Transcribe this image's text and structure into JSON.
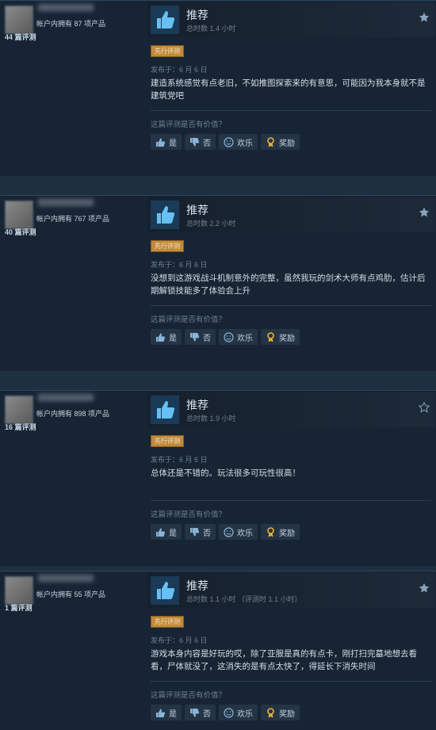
{
  "reviews": [
    {
      "products": "帐户内拥有 87 项产品",
      "review_count": "44 篇评测",
      "recommend": "推荐",
      "hours": "总时数 1.4 小时",
      "early_access": "先行评测",
      "posted": "发布于：6 月 6 日",
      "text": "建造系统感觉有点老旧，不如推图探索来的有意思，可能因为我本身就不是建筑党吧",
      "helpful_q": "这篇评测是否有价值？",
      "btn_yes": "是",
      "btn_no": "否",
      "btn_funny": "欢乐",
      "btn_award": "奖励",
      "star_filled": true
    },
    {
      "products": "帐户内拥有 767 项产品",
      "review_count": "40 篇评测",
      "recommend": "推荐",
      "hours": "总时数 2.2 小时",
      "early_access": "先行评测",
      "posted": "发布于：6 月 6 日",
      "text": "没想到这游戏战斗机制意外的完整，虽然我玩的剑术大师有点鸡肋，估计后期解锁技能多了体验会上升",
      "helpful_q": "这篇评测是否有价值？",
      "btn_yes": "是",
      "btn_no": "否",
      "btn_funny": "欢乐",
      "btn_award": "奖励",
      "star_filled": true
    },
    {
      "products": "帐户内拥有 898 项产品",
      "review_count": "16 篇评测",
      "recommend": "推荐",
      "hours": "总时数 1.9 小时",
      "early_access": "先行评测",
      "posted": "发布于：6 月 6 日",
      "text": "总体还是不错的。玩法很多可玩性很高！",
      "helpful_q": "这篇评测是否有价值？",
      "btn_yes": "是",
      "btn_no": "否",
      "btn_funny": "欢乐",
      "btn_award": "奖励",
      "star_filled": false
    },
    {
      "products": "帐户内拥有 55 项产品",
      "review_count": "1 篇评测",
      "recommend": "推荐",
      "hours": "总时数 1.1 小时 （评测时 1.1 小时）",
      "early_access": "先行评测",
      "posted": "发布于：6 月 6 日",
      "text": "游戏本身内容是好玩的哎，除了亚服是真的有点卡，刚打扫完墓地想去看看，尸体就没了，这消失的是有点太快了，得延长下消失时间",
      "helpful_q": "这篇评测是否有价值？",
      "btn_yes": "是",
      "btn_no": "否",
      "btn_funny": "欢乐",
      "btn_award": "奖励",
      "star_filled": true
    }
  ],
  "colors": {
    "background": "#1b2838",
    "card": "#172434",
    "early_access_badge": "#c28a3a",
    "thumb_blue": "#66c0f4"
  }
}
